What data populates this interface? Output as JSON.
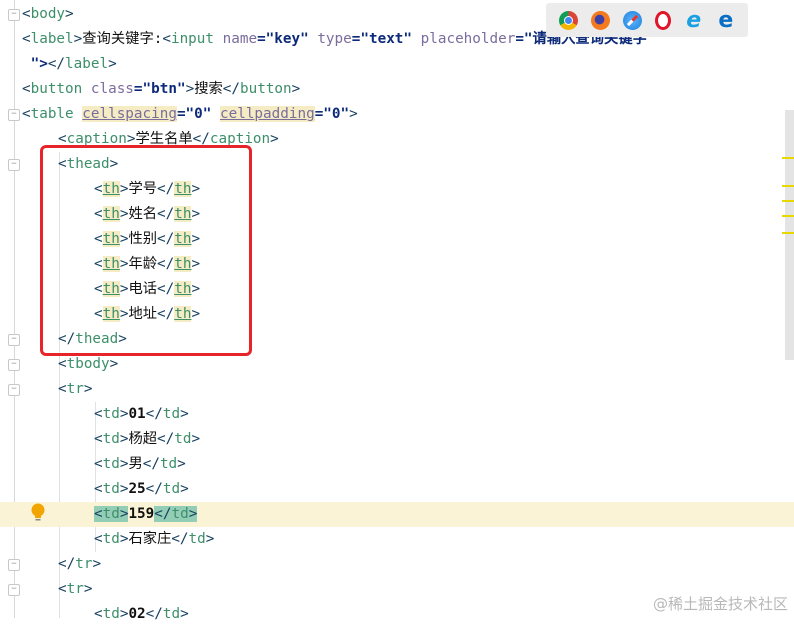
{
  "colors": {
    "highlight_box": "#e8242b",
    "caret_line": "#fbf3d5",
    "tag_match": "#93cdb5"
  },
  "browser_icons": [
    "chrome-icon",
    "firefox-icon",
    "safari-icon",
    "opera-icon",
    "ie-icon",
    "edge-icon"
  ],
  "lines": [
    {
      "indent": 0,
      "tokens": [
        [
          "br",
          "<"
        ],
        [
          "tn",
          "body"
        ],
        [
          "br",
          ">"
        ]
      ]
    },
    {
      "indent": 0,
      "tokens": [
        [
          "br",
          "<"
        ],
        [
          "tn",
          "label"
        ],
        [
          "br",
          ">"
        ],
        [
          "tx",
          "查询关键字:"
        ],
        [
          "br",
          "<"
        ],
        [
          "tn",
          "input "
        ],
        [
          "an",
          "name"
        ],
        [
          "av",
          "=\"key\" "
        ],
        [
          "an",
          "type"
        ],
        [
          "av",
          "=\"text\" "
        ],
        [
          "an",
          "placeholder"
        ],
        [
          "av",
          "=\"请输入查询关键字"
        ]
      ]
    },
    {
      "indent": 0,
      "tokens": [
        [
          "av",
          " \">"
        ],
        [
          "br",
          "</"
        ],
        [
          "tn",
          "label"
        ],
        [
          "br",
          ">"
        ]
      ]
    },
    {
      "indent": 0,
      "tokens": [
        [
          "br",
          "<"
        ],
        [
          "tn",
          "button "
        ],
        [
          "an",
          "class"
        ],
        [
          "av",
          "=\"btn\""
        ],
        [
          "br",
          ">"
        ],
        [
          "tx",
          "搜索"
        ],
        [
          "br",
          "</"
        ],
        [
          "tn",
          "button"
        ],
        [
          "br",
          ">"
        ]
      ]
    },
    {
      "indent": 0,
      "tokens": [
        [
          "br",
          "<"
        ],
        [
          "tn",
          "table "
        ],
        [
          "an hl ul",
          "cellspacing"
        ],
        [
          "av",
          "=\"0\" "
        ],
        [
          "an hl ul",
          "cellpadding"
        ],
        [
          "av",
          "=\"0\""
        ],
        [
          "br",
          ">"
        ]
      ]
    },
    {
      "indent": 1,
      "tokens": [
        [
          "br",
          "<"
        ],
        [
          "tn",
          "caption"
        ],
        [
          "br",
          ">"
        ],
        [
          "tx",
          "学生名单"
        ],
        [
          "br",
          "</"
        ],
        [
          "tn",
          "caption"
        ],
        [
          "br",
          ">"
        ]
      ]
    },
    {
      "indent": 1,
      "tokens": [
        [
          "br",
          "<"
        ],
        [
          "tn",
          "thead"
        ],
        [
          "br",
          ">"
        ]
      ]
    },
    {
      "indent": 2,
      "tokens": [
        [
          "br",
          "<"
        ],
        [
          "tn hl ul",
          "th"
        ],
        [
          "br",
          ">"
        ],
        [
          "tx",
          "学号"
        ],
        [
          "br",
          "</"
        ],
        [
          "tn hl ul",
          "th"
        ],
        [
          "br",
          ">"
        ]
      ]
    },
    {
      "indent": 2,
      "tokens": [
        [
          "br",
          "<"
        ],
        [
          "tn hl ul",
          "th"
        ],
        [
          "br",
          ">"
        ],
        [
          "tx",
          "姓名"
        ],
        [
          "br",
          "</"
        ],
        [
          "tn hl ul",
          "th"
        ],
        [
          "br",
          ">"
        ]
      ]
    },
    {
      "indent": 2,
      "tokens": [
        [
          "br",
          "<"
        ],
        [
          "tn hl ul",
          "th"
        ],
        [
          "br",
          ">"
        ],
        [
          "tx",
          "性别"
        ],
        [
          "br",
          "</"
        ],
        [
          "tn hl ul",
          "th"
        ],
        [
          "br",
          ">"
        ]
      ]
    },
    {
      "indent": 2,
      "tokens": [
        [
          "br",
          "<"
        ],
        [
          "tn hl ul",
          "th"
        ],
        [
          "br",
          ">"
        ],
        [
          "tx",
          "年龄"
        ],
        [
          "br",
          "</"
        ],
        [
          "tn hl ul",
          "th"
        ],
        [
          "br",
          ">"
        ]
      ]
    },
    {
      "indent": 2,
      "tokens": [
        [
          "br",
          "<"
        ],
        [
          "tn hl ul",
          "th"
        ],
        [
          "br",
          ">"
        ],
        [
          "tx",
          "电话"
        ],
        [
          "br",
          "</"
        ],
        [
          "tn hl ul",
          "th"
        ],
        [
          "br",
          ">"
        ]
      ]
    },
    {
      "indent": 2,
      "tokens": [
        [
          "br",
          "<"
        ],
        [
          "tn hl ul",
          "th"
        ],
        [
          "br",
          ">"
        ],
        [
          "tx",
          "地址"
        ],
        [
          "br",
          "</"
        ],
        [
          "tn hl ul",
          "th"
        ],
        [
          "br",
          ">"
        ]
      ]
    },
    {
      "indent": 1,
      "tokens": [
        [
          "br",
          "</"
        ],
        [
          "tn",
          "thead"
        ],
        [
          "br",
          ">"
        ]
      ]
    },
    {
      "indent": 1,
      "tokens": [
        [
          "br",
          "<"
        ],
        [
          "tn",
          "tbody"
        ],
        [
          "br",
          ">"
        ]
      ]
    },
    {
      "indent": 1,
      "tokens": [
        [
          "br",
          "<"
        ],
        [
          "tn",
          "tr"
        ],
        [
          "br",
          ">"
        ]
      ]
    },
    {
      "indent": 2,
      "tokens": [
        [
          "br",
          "<"
        ],
        [
          "tn",
          "td"
        ],
        [
          "br",
          ">"
        ],
        [
          "num",
          "01"
        ],
        [
          "br",
          "</"
        ],
        [
          "tn",
          "td"
        ],
        [
          "br",
          ">"
        ]
      ]
    },
    {
      "indent": 2,
      "tokens": [
        [
          "br",
          "<"
        ],
        [
          "tn",
          "td"
        ],
        [
          "br",
          ">"
        ],
        [
          "tx",
          "杨超"
        ],
        [
          "br",
          "</"
        ],
        [
          "tn",
          "td"
        ],
        [
          "br",
          ">"
        ]
      ]
    },
    {
      "indent": 2,
      "tokens": [
        [
          "br",
          "<"
        ],
        [
          "tn",
          "td"
        ],
        [
          "br",
          ">"
        ],
        [
          "tx",
          "男"
        ],
        [
          "br",
          "</"
        ],
        [
          "tn",
          "td"
        ],
        [
          "br",
          ">"
        ]
      ]
    },
    {
      "indent": 2,
      "tokens": [
        [
          "br",
          "<"
        ],
        [
          "tn",
          "td"
        ],
        [
          "br",
          ">"
        ],
        [
          "num",
          "25"
        ],
        [
          "br",
          "</"
        ],
        [
          "tn",
          "td"
        ],
        [
          "br",
          ">"
        ]
      ]
    },
    {
      "indent": 2,
      "caret": true,
      "tokens": [
        [
          "br mt",
          "<"
        ],
        [
          "tn mt",
          "td"
        ],
        [
          "br mt",
          ">"
        ],
        [
          "num",
          "159"
        ],
        [
          "br mt",
          "</"
        ],
        [
          "tn mt",
          "td"
        ],
        [
          "br mt",
          ">"
        ]
      ]
    },
    {
      "indent": 2,
      "tokens": [
        [
          "br",
          "<"
        ],
        [
          "tn",
          "td"
        ],
        [
          "br",
          ">"
        ],
        [
          "tx",
          "石家庄"
        ],
        [
          "br",
          "</"
        ],
        [
          "tn",
          "td"
        ],
        [
          "br",
          ">"
        ]
      ]
    },
    {
      "indent": 1,
      "tokens": [
        [
          "br",
          "</"
        ],
        [
          "tn",
          "tr"
        ],
        [
          "br",
          ">"
        ]
      ]
    },
    {
      "indent": 1,
      "tokens": [
        [
          "br",
          "<"
        ],
        [
          "tn",
          "tr"
        ],
        [
          "br",
          ">"
        ]
      ]
    },
    {
      "indent": 2,
      "tokens": [
        [
          "br",
          "<"
        ],
        [
          "tn",
          "td"
        ],
        [
          "br",
          ">"
        ],
        [
          "num",
          "02"
        ],
        [
          "br",
          "</"
        ],
        [
          "tn",
          "td"
        ],
        [
          "br",
          ">"
        ]
      ]
    }
  ],
  "watermark": "@稀土掘金技术社区"
}
